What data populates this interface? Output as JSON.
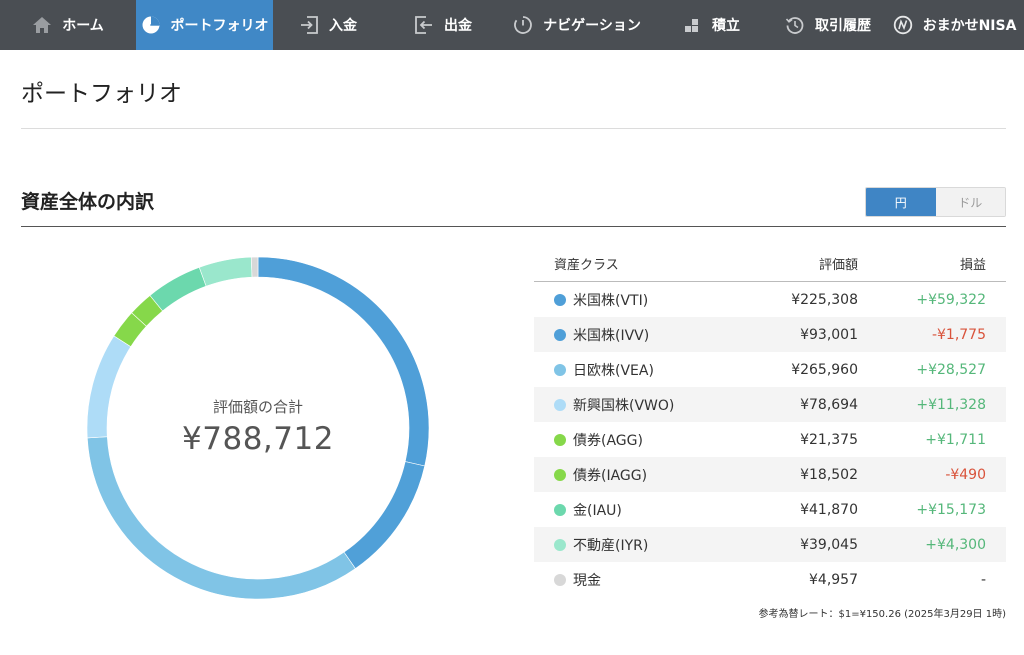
{
  "nav": {
    "items": [
      {
        "label": "ホーム",
        "icon": "home-icon"
      },
      {
        "label": "ポートフォリオ",
        "icon": "pie-chart-icon",
        "active": true
      },
      {
        "label": "入金",
        "icon": "deposit-icon"
      },
      {
        "label": "出金",
        "icon": "withdraw-icon"
      },
      {
        "label": "ナビゲーション",
        "icon": "navigation-icon"
      },
      {
        "label": "積立",
        "icon": "accumulate-icon"
      },
      {
        "label": "取引履歴",
        "icon": "history-icon"
      },
      {
        "label": "おまかせNISA",
        "icon": "nisa-icon"
      }
    ]
  },
  "page": {
    "title": "ポートフォリオ"
  },
  "section": {
    "title": "資産全体の内訳",
    "currency_yen": "円",
    "currency_usd": "ドル"
  },
  "donut": {
    "label": "評価額の合計",
    "total": "¥788,712"
  },
  "table": {
    "headers": {
      "asset_class": "資産クラス",
      "value": "評価額",
      "pl": "損益"
    },
    "rows": [
      {
        "name": "米国株(VTI)",
        "value": "¥225,308",
        "pl": "+¥59,322",
        "trend": "pos",
        "color": "#4f9fd8",
        "amount": 225308
      },
      {
        "name": "米国株(IVV)",
        "value": "¥93,001",
        "pl": "-¥1,775",
        "trend": "neg",
        "color": "#4f9fd8",
        "amount": 93001
      },
      {
        "name": "日欧株(VEA)",
        "value": "¥265,960",
        "pl": "+¥28,527",
        "trend": "pos",
        "color": "#80c4e6",
        "amount": 265960
      },
      {
        "name": "新興国株(VWO)",
        "value": "¥78,694",
        "pl": "+¥11,328",
        "trend": "pos",
        "color": "#aedcf7",
        "amount": 78694
      },
      {
        "name": "債券(AGG)",
        "value": "¥21,375",
        "pl": "+¥1,711",
        "trend": "pos",
        "color": "#86d84a",
        "amount": 21375
      },
      {
        "name": "債券(IAGG)",
        "value": "¥18,502",
        "pl": "-¥490",
        "trend": "neg",
        "color": "#86d84a",
        "amount": 18502
      },
      {
        "name": "金(IAU)",
        "value": "¥41,870",
        "pl": "+¥15,173",
        "trend": "pos",
        "color": "#6cd8ad",
        "amount": 41870
      },
      {
        "name": "不動産(IYR)",
        "value": "¥39,045",
        "pl": "+¥4,300",
        "trend": "pos",
        "color": "#9ae7cc",
        "amount": 39045
      },
      {
        "name": "現金",
        "value": "¥4,957",
        "pl": "-",
        "trend": "neu",
        "color": "#d8d8d8",
        "amount": 4957
      }
    ]
  },
  "donut_segment_colors": [
    "#4f9fd8",
    "#50a0d8",
    "#80c4e6",
    "#aedcf7",
    "#86d84a",
    "#86d84a",
    "#6cd8ad",
    "#9ae7cc",
    "#d8d8d8"
  ],
  "note": "参考為替レート：$1=¥150.26 (2025年3月29日 1時)"
}
